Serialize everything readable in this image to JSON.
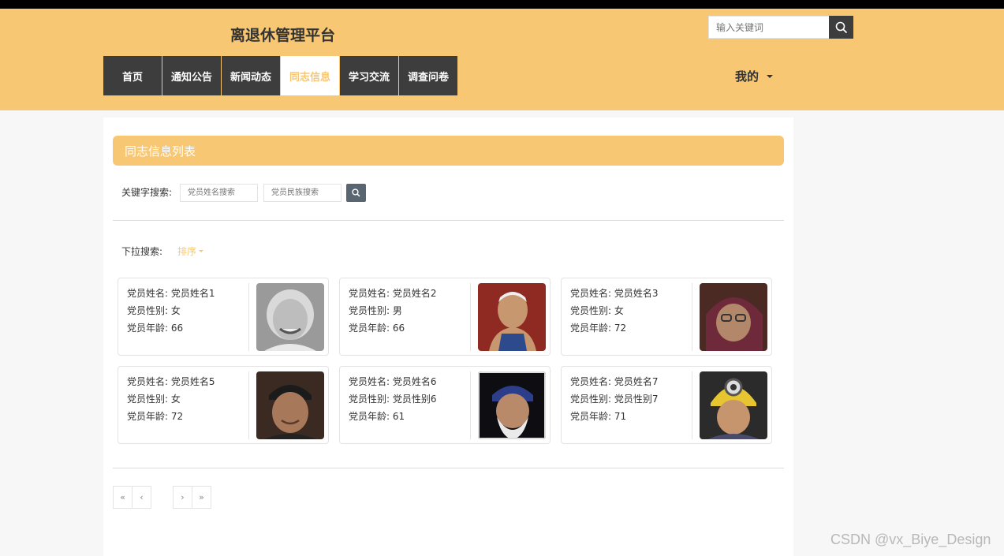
{
  "header": {
    "site_title": "离退休管理平台",
    "search_placeholder": "输入关键词",
    "nav": [
      {
        "label": "首页",
        "active": false
      },
      {
        "label": "通知公告",
        "active": false
      },
      {
        "label": "新闻动态",
        "active": false
      },
      {
        "label": "同志信息",
        "active": true
      },
      {
        "label": "学习交流",
        "active": false
      },
      {
        "label": "调查问卷",
        "active": false
      }
    ],
    "mine_label": "我的"
  },
  "main": {
    "panel_title": "同志信息列表",
    "keyword_label": "关键字搜索:",
    "name_search_placeholder": "党员姓名搜索",
    "ethnicity_search_placeholder": "党员民族搜索",
    "dropdown_label": "下拉搜索:",
    "sort_label": "排序"
  },
  "cards": [
    {
      "name": "党员姓名: 党员姓名1",
      "gender": "党员性别: 女",
      "age": "党员年龄: 66"
    },
    {
      "name": "党员姓名: 党员姓名2",
      "gender": "党员性别: 男",
      "age": "党员年龄: 66"
    },
    {
      "name": "党员姓名: 党员姓名3",
      "gender": "党员性别: 女",
      "age": "党员年龄: 72"
    },
    {
      "name": "党员姓名: 党员姓名5",
      "gender": "党员性别: 女",
      "age": "党员年龄: 72"
    },
    {
      "name": "党员姓名: 党员姓名6",
      "gender": "党员性别: 党员性别6",
      "age": "党员年龄: 61"
    },
    {
      "name": "党员姓名: 党员姓名7",
      "gender": "党员性别: 党员性别7",
      "age": "党员年龄: 71"
    }
  ],
  "pagination": {
    "first": "«",
    "prev": "‹",
    "next": "›",
    "last": "»"
  },
  "watermark": "CSDN @vx_Biye_Design",
  "colors": {
    "accent": "#f8c773",
    "nav_dark": "#3d3d3d",
    "search_button": "#596570"
  },
  "icons": {
    "search": "search-icon",
    "dropdown": "caret-down-icon"
  }
}
